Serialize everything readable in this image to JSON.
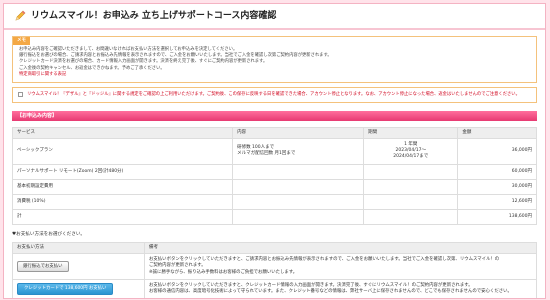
{
  "page": {
    "title": "リウムスマイル！お申込み 立ち上げサポートコース内容確認",
    "icon": "pencil-icon"
  },
  "memo": {
    "tag": "メモ",
    "lines": [
      "お申込み内容をご確認いただきまして、お間違いなければお支払い方法を選択してお申込みを決定してください。",
      "銀行振込をお選びの場合、ご請求内容とお振込み先情報を表示されますので、ご入金をお願いいたします。当社でご入金を確認し次第ご契約内容が更新されます。",
      "クレジットカード決済をお選びの場合、カード情報入力画面が開きます。決済を終え完了後、すぐにご契約内容が更新されます。",
      "ご入金後の契約キャンセル、お返金はできかねます。予めご了承ください。"
    ],
    "red_line": "特定商取引に関する表記"
  },
  "notice": {
    "text": "リウムスマイル！『デザル』と『ドッジル』に関する規定をご確認の上ご利用いただけます。ご契約後、この保存に反映する日を確認できた場合、アカウント停止となります。なお、アカウント停止になった場合、返金はいたしませんのでご注意ください。"
  },
  "order_section": {
    "heading": "【お申込み内容】",
    "columns": [
      "サービス",
      "内容",
      "期間",
      "金額"
    ],
    "rows": [
      {
        "service": "ベーシックプラン",
        "content_1": "研修数 100人まで",
        "content_2": "メルマガ配信回数 月1回まで",
        "period_1": "1 年間",
        "period_2": "2023/04/17〜",
        "period_3": "2024/04/17まで",
        "amount": "36,000円"
      },
      {
        "service": "パーソナルサポート リモート(Zoom) 2回(計480分)",
        "content_1": "",
        "period_1": "",
        "amount": "60,000円"
      },
      {
        "service": "基本初期設定費用",
        "content_1": "",
        "period_1": "",
        "amount": "30,000円"
      },
      {
        "service": "消費税 (10%)",
        "content_1": "",
        "period_1": "",
        "amount": "12,600円"
      },
      {
        "service": "計",
        "content_1": "",
        "period_1": "",
        "amount": "138,600円"
      }
    ]
  },
  "pay_section": {
    "label": "♥お支払い方法をお選びください。",
    "columns": [
      "お支払い方法",
      "備考"
    ],
    "bank": {
      "button": "銀行振込でお支払い",
      "note_1": "お支払いボタンをクリックしていただきますと、ご請求内容とお振込み先情報が表示されますので、ご入金をお願いいたします。当社でご入金を確認し次第、リウムスマイル！の",
      "note_2": "ご契約内容が更新されます。",
      "note_3": "※誠に勝手ながら、振り込み手数料はお客様のご負担でお願いいたします。"
    },
    "card": {
      "button": "クレジットカードで 138,600円 お支払い",
      "note_1": "お支払いボタンをクリックしていただきますと、クレジットカード情報の入力画面が開きます。決済完了後、すぐにリウムスマイル！のご契約内容が更新されます。",
      "note_2": "お客様の通信内容は、高度暗号化技術によって守られています。また、クレジット番号などの情報は、弊社サーバ上に保存されませんので、どこでも保存されませんので安心ください。"
    }
  },
  "colors": {
    "accent": "#e73a72",
    "memo_border": "#f4c27c",
    "card_button": "#2b95d1"
  }
}
